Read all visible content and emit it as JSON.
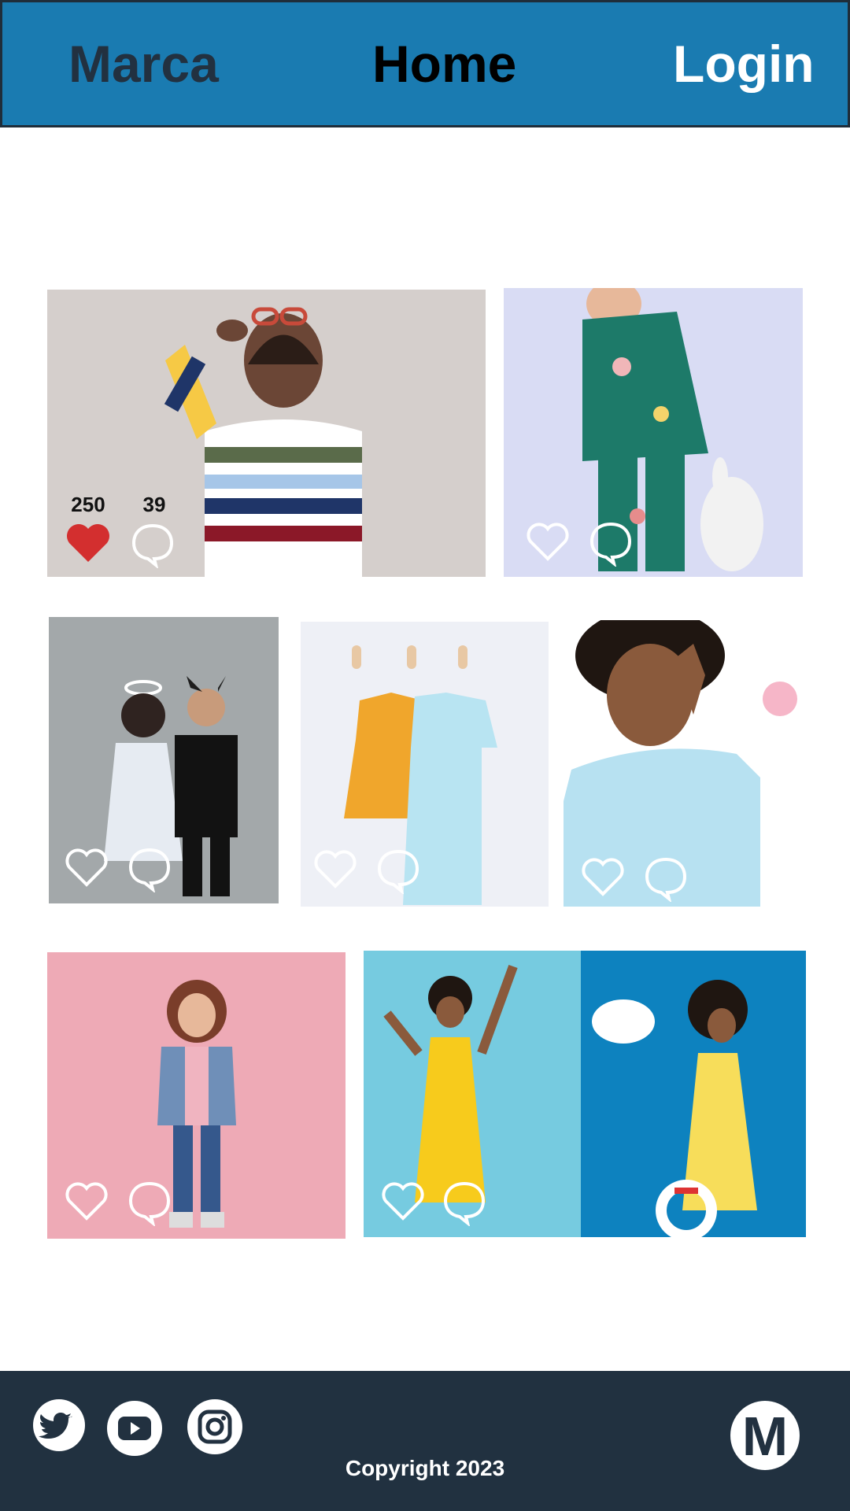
{
  "header": {
    "brand": "Marca",
    "nav_home": "Home",
    "nav_login": "Login",
    "background": "#1a7bb1"
  },
  "gallery": {
    "cards": [
      {
        "id": "card-1",
        "scene": "boy in striped sweater with sunglasses",
        "liked": true,
        "likes": "250",
        "comments": "39"
      },
      {
        "id": "card-2",
        "scene": "child in green pajamas with plush toy",
        "liked": false
      },
      {
        "id": "card-3",
        "scene": "two kids in angel and devil costumes",
        "liked": false
      },
      {
        "id": "card-4",
        "scene": "yellow dress and blue romper on hangers",
        "liked": false
      },
      {
        "id": "card-5",
        "scene": "smiling child in light blue sweater",
        "liked": false
      },
      {
        "id": "card-6",
        "scene": "girl in denim jacket on pink background",
        "liked": false
      },
      {
        "id": "card-7",
        "scene": "girl in yellow dress on blue background",
        "liked": false
      }
    ],
    "icons": {
      "like": "heart-icon",
      "comment": "comment-bubble-icon"
    },
    "like_color": "#d32f2f"
  },
  "footer": {
    "social": [
      "twitter-icon",
      "youtube-icon",
      "instagram-icon"
    ],
    "logo_letter": "M",
    "copyright": "Copyright 2023",
    "background": "#213140"
  }
}
